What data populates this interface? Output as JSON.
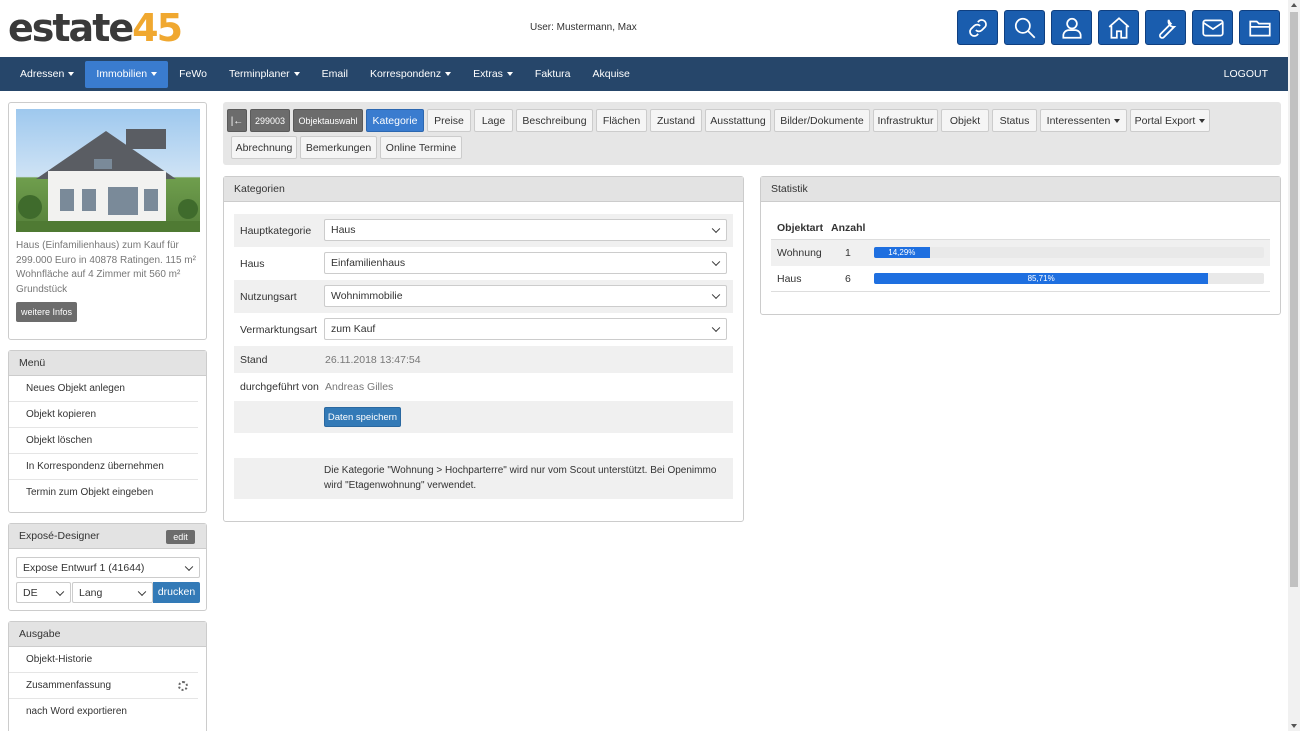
{
  "header": {
    "logo_part1": "estate",
    "logo_part2": "45",
    "user": "User: Mustermann, Max",
    "icons": [
      "link-icon",
      "search-icon",
      "user-icon",
      "home-icon",
      "wrench-icon",
      "mail-icon",
      "folder-icon"
    ]
  },
  "nav": {
    "items": [
      {
        "label": "Adressen",
        "dropdown": true
      },
      {
        "label": "Immobilien",
        "dropdown": true,
        "active": true
      },
      {
        "label": "FeWo",
        "dropdown": false
      },
      {
        "label": "Terminplaner",
        "dropdown": true
      },
      {
        "label": "Email",
        "dropdown": false
      },
      {
        "label": "Korrespondenz",
        "dropdown": true
      },
      {
        "label": "Extras",
        "dropdown": true
      },
      {
        "label": "Faktura",
        "dropdown": false
      },
      {
        "label": "Akquise",
        "dropdown": false
      }
    ],
    "logout": "LOGOUT"
  },
  "property": {
    "description": "Haus (Einfamilienhaus) zum Kauf für 299.000 Euro in 40878 Ratingen. 115 m² Wohnfläche auf 4 Zimmer mit 560 m² Grundstück",
    "more_button": "weitere Infos"
  },
  "menu": {
    "title": "Menü",
    "items": [
      "Neues Objekt anlegen",
      "Objekt kopieren",
      "Objekt löschen",
      "In Korrespondenz übernehmen",
      "Termin zum Objekt eingeben"
    ]
  },
  "expose": {
    "title": "Exposé-Designer",
    "edit": "edit",
    "template": "Expose Entwurf 1 (41644)",
    "language": "DE",
    "length": "Lang",
    "print": "drucken"
  },
  "output": {
    "title": "Ausgabe",
    "items": [
      "Objekt-Historie",
      "Zusammenfassung",
      "nach Word exportieren"
    ]
  },
  "tabs": {
    "first_icon": "first-page-icon",
    "object_id": "299003",
    "object_select": "Objektauswahl",
    "row1": [
      "Kategorie",
      "Preise",
      "Lage",
      "Beschreibung",
      "Flächen",
      "Zustand",
      "Ausstattung",
      "Bilder/Dokumente",
      "Infrastruktur",
      "Objekt",
      "Status",
      "Interessenten",
      "Portal Export"
    ],
    "row2": [
      "Abrechnung",
      "Bemerkungen",
      "Online Termine"
    ],
    "active": "Kategorie"
  },
  "kategorien": {
    "title": "Kategorien",
    "fields": [
      {
        "label": "Hauptkategorie",
        "value": "Haus"
      },
      {
        "label": "Haus",
        "value": "Einfamilienhaus"
      },
      {
        "label": "Nutzungsart",
        "value": "Wohnimmobilie"
      },
      {
        "label": "Vermarktungsart",
        "value": "zum Kauf"
      }
    ],
    "stand_label": "Stand",
    "stand_value": "26.11.2018 13:47:54",
    "by_label": "durchgeführt von",
    "by_value": "Andreas Gilles",
    "save": "Daten speichern",
    "note": "Die Kategorie \"Wohnung > Hochparterre\" wird nur vom Scout unterstützt. Bei Openimmo wird \"Etagenwohnung\" verwendet."
  },
  "statistik": {
    "title": "Statistik",
    "col_type": "Objektart",
    "col_count": "Anzahl",
    "rows": [
      {
        "type": "Wohnung",
        "count": "1",
        "percent": 14.29,
        "label": "14,29%"
      },
      {
        "type": "Haus",
        "count": "6",
        "percent": 85.71,
        "label": "85,71%"
      }
    ],
    "bar_color": "#1e6fe0"
  }
}
